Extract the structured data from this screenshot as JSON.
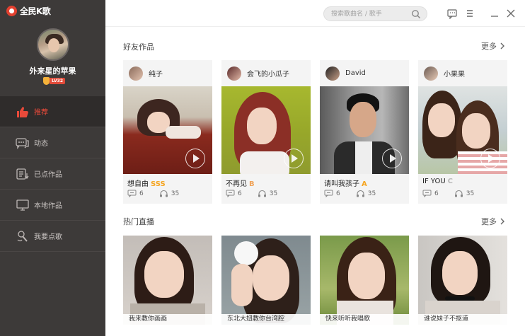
{
  "app": {
    "name": "全民K歌"
  },
  "user": {
    "name": "外来星的苹果",
    "level": "LV32"
  },
  "nav": [
    {
      "label": "推荐",
      "icon": "thumbs-up-icon",
      "active": true
    },
    {
      "label": "动态",
      "icon": "chat-bubbles-icon",
      "active": false
    },
    {
      "label": "已点作品",
      "icon": "song-list-icon",
      "active": false
    },
    {
      "label": "本地作品",
      "icon": "monitor-icon",
      "active": false
    },
    {
      "label": "我要点歌",
      "icon": "microphone-icon",
      "active": false
    }
  ],
  "search": {
    "placeholder": "搜索歌曲名 / 歌手"
  },
  "friends": {
    "title": "好友作品",
    "more": "更多",
    "cards": [
      {
        "user": "纯子",
        "song": "想自由",
        "grade": "SSS",
        "comments": "6",
        "listens": "35"
      },
      {
        "user": "会飞的小瓜子",
        "song": "不再见",
        "grade": "B",
        "comments": "6",
        "listens": "35"
      },
      {
        "user": "David",
        "song": "请叫我孩子",
        "grade": "A",
        "comments": "6",
        "listens": "35"
      },
      {
        "user": "小果果",
        "song": "IF YOU",
        "grade": "C",
        "comments": "6",
        "listens": "35"
      }
    ]
  },
  "live": {
    "title": "热门直播",
    "more": "更多",
    "rooms": [
      {
        "caption": "我来教你画画"
      },
      {
        "caption": "东北大妞教你台湾腔"
      },
      {
        "caption": "快来听听我唱歌"
      },
      {
        "caption": "谁说妹子不抠道"
      }
    ]
  },
  "colors": {
    "sidebar": "#3d3a39",
    "accent": "#e94a3a",
    "grade": "#f5a623"
  }
}
